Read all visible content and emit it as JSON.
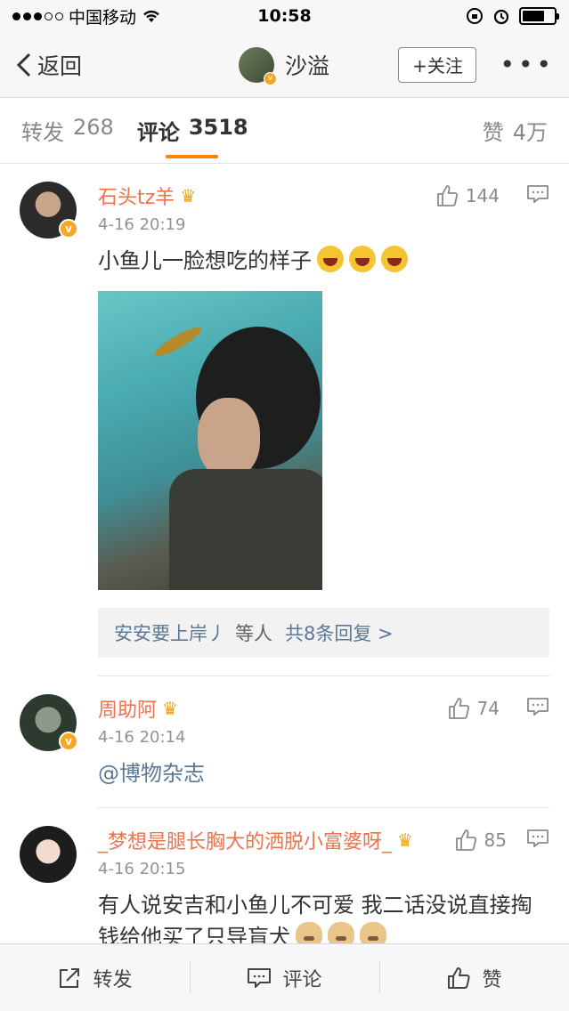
{
  "status": {
    "carrier": "中国移动",
    "time": "10:58"
  },
  "nav": {
    "back_label": "返回",
    "title": "沙溢",
    "follow_label": "+关注",
    "more_label": "•••"
  },
  "tabs": [
    {
      "label": "转发",
      "count": "268"
    },
    {
      "label": "评论",
      "count": "3518"
    },
    {
      "label": "赞",
      "count": "4万"
    }
  ],
  "comments": [
    {
      "name": "石头tz羊",
      "time": "4-16 20:19",
      "likes": "144",
      "text": "小鱼儿一脸想吃的样子",
      "replies": {
        "user": "安安要上岸丿",
        "others": "等人",
        "count": "共8条回复 >"
      }
    },
    {
      "name": "周助阿",
      "time": "4-16 20:14",
      "likes": "74",
      "text": "@博物杂志"
    },
    {
      "name": "_梦想是腿长胸大的洒脱小富婆呀_",
      "time": "4-16 20:15",
      "likes": "85",
      "text": "有人说安吉和小鱼儿不可爱  我二话没说直接掏钱给他买了只导盲犬"
    }
  ],
  "toolbar": {
    "repost_label": "转发",
    "comment_label": "评论",
    "like_label": "赞"
  },
  "colors": {
    "accent": "#ff8200",
    "name": "#eb7350",
    "link": "#5d7895"
  }
}
